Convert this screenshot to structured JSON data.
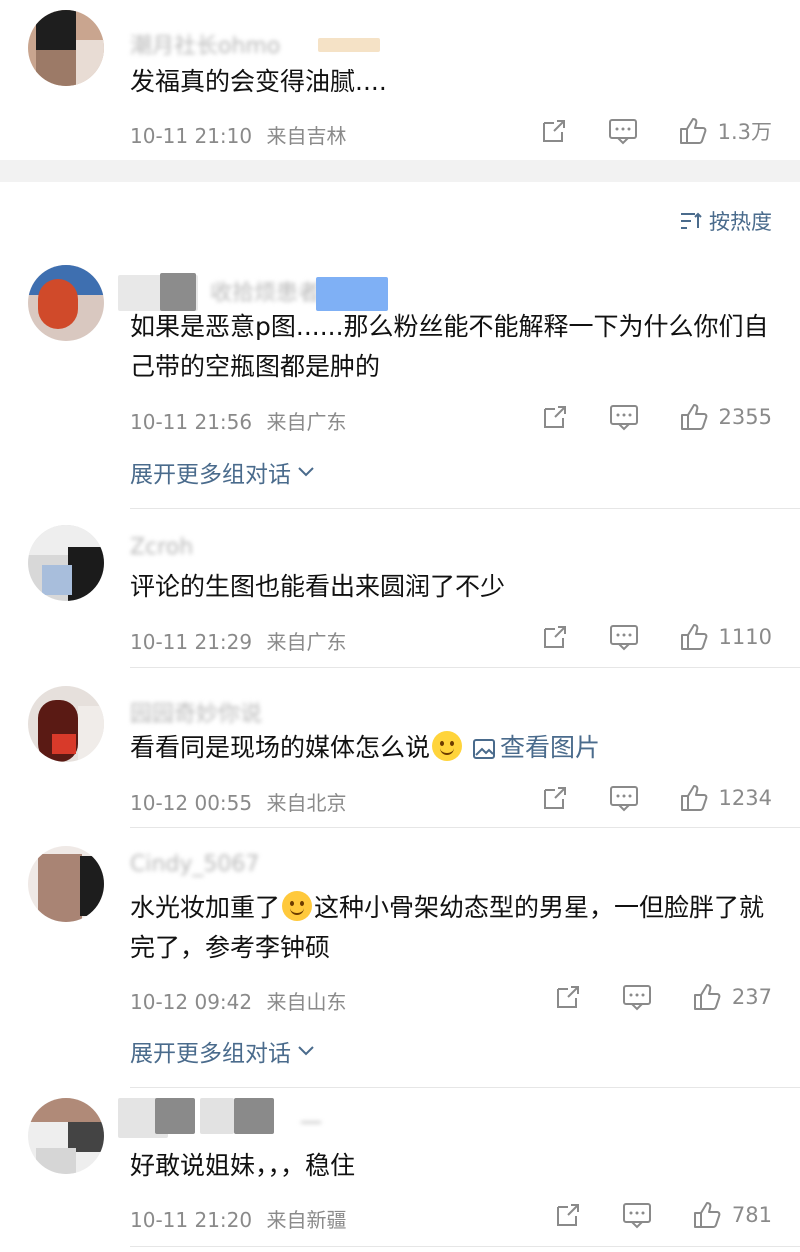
{
  "colors": {
    "accent": "#4a6b8c",
    "meta": "#8a8a8a",
    "divider": "#e6e6e6"
  },
  "top_comment": {
    "name": "潮月社长ohmo",
    "text": "发福真的会变得油腻....",
    "time": "10-11 21:10",
    "location": "来自吉林",
    "likes": "1.3万"
  },
  "sort": {
    "label": "按热度",
    "icon": "sort-icon"
  },
  "comments": [
    {
      "name": "收拾烦患者",
      "text": "如果是恶意p图......那么粉丝能不能解释一下为什么你们自己带的空瓶图都是肿的",
      "time": "10-11 21:56",
      "location": "来自广东",
      "likes": "2355",
      "expand": "展开更多组对话"
    },
    {
      "name": "Zcroh",
      "text": "评论的生图也能看出来圆润了不少",
      "time": "10-11 21:29",
      "location": "来自广东",
      "likes": "1110"
    },
    {
      "name": "园园奇妙你说",
      "text_before": "看看同是现场的媒体怎么说",
      "emoji": "smile-emoji",
      "link": "查看图片",
      "time": "10-12 00:55",
      "location": "来自北京",
      "likes": "1234"
    },
    {
      "name": "Cindy_5067",
      "text_before": "水光妆加重了",
      "emoji": "crying-laughing-emoji",
      "text_after": "这种小骨架幼态型的男星，一但脸胖了就完了，参考李钟硕",
      "time": "10-12 09:42",
      "location": "来自山东",
      "likes": "237",
      "expand": "展开更多组对话"
    },
    {
      "name": "一",
      "text": "好敢说姐妹，，，稳住",
      "time": "10-11 21:20",
      "location": "来自新疆",
      "likes": "781"
    }
  ]
}
